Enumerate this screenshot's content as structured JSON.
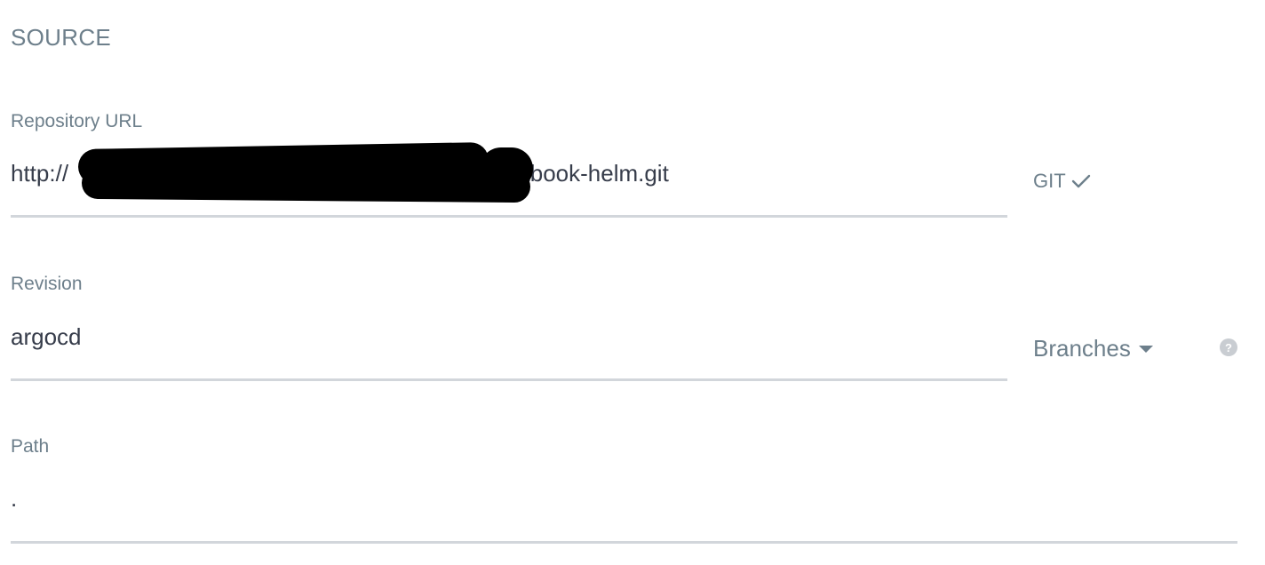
{
  "section": {
    "title": "SOURCE"
  },
  "repository": {
    "label": "Repository URL",
    "value_prefix": "http://",
    "value_suffix": "/gitbook-helm.git",
    "type_badge": "GIT",
    "check_icon": "check-icon"
  },
  "revision": {
    "label": "Revision",
    "value": "argocd",
    "dropdown_label": "Branches",
    "dropdown_icon": "caret-down-icon",
    "help_icon": "help-circle-icon",
    "help_glyph": "?"
  },
  "path": {
    "label": "Path",
    "value": "."
  },
  "colors": {
    "label": "#6d7f8b",
    "text": "#363c4a",
    "underline": "#d2d6db",
    "help": "#c9cdd2"
  }
}
